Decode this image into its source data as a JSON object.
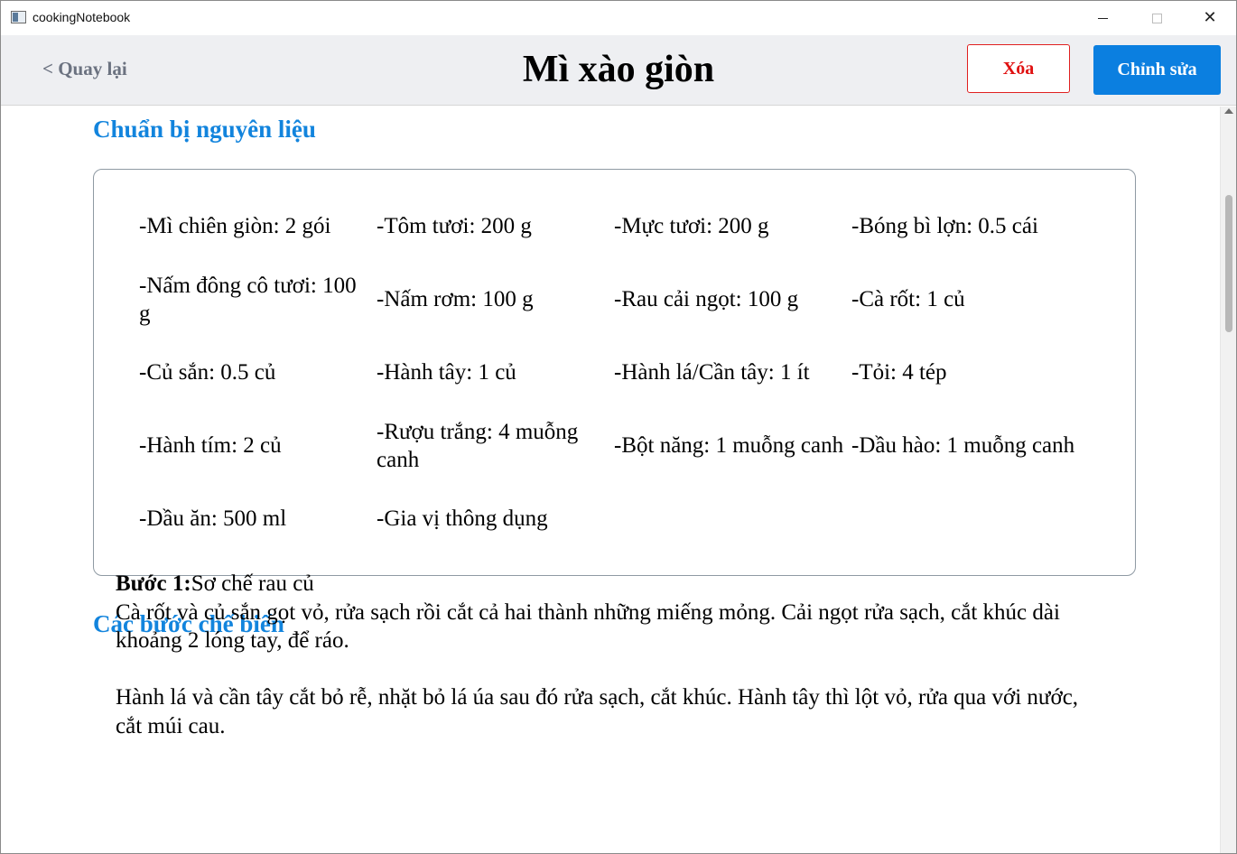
{
  "window": {
    "title": "cookingNotebook",
    "icons": {
      "app": "app-window-icon",
      "minimize": "minimize-icon",
      "maximize": "maximize-icon",
      "close": "close-icon"
    },
    "close_glyph": "✕"
  },
  "header": {
    "back_label": "< Quay lại",
    "title": "Mì xào giòn",
    "delete_label": "Xóa",
    "edit_label": "Chỉnh sửa"
  },
  "colors": {
    "accent": "#0b7fe0",
    "heading": "#1284dd",
    "danger": "#e01010",
    "header_bg": "#eeeff2",
    "back_link": "#6b7280"
  },
  "ingredients": {
    "heading": "Chuẩn bị nguyên liệu",
    "items": [
      "-Mì chiên giòn: 2 gói",
      "-Tôm tươi: 200 g",
      "-Mực tươi: 200 g",
      "-Bóng bì lợn: 0.5 cái",
      "-Nấm đông cô tươi: 100 g",
      "-Nấm rơm: 100 g",
      "-Rau cải ngọt: 100 g",
      "-Cà rốt: 1 củ",
      "-Củ sắn: 0.5 củ",
      "-Hành tây: 1 củ",
      "-Hành lá/Cần tây: 1 ít",
      "-Tỏi: 4 tép",
      "-Hành tím: 2 củ",
      "-Rượu trắng: 4 muỗng canh",
      "-Bột năng: 1 muỗng canh",
      "-Dầu hào: 1 muỗng canh",
      "-Dầu ăn: 500 ml",
      "-Gia vị thông dụng"
    ]
  },
  "steps": {
    "heading": "Các bước chế biến",
    "step1": {
      "label": "Bước 1:",
      "title": "Sơ chế rau củ",
      "paragraphs": [
        "Cà rốt và củ sắn gọt vỏ, rửa sạch rồi cắt cả hai thành những miếng mỏng. Cải ngọt rửa sạch, cắt khúc dài khoảng 2 lóng tay, để ráo.",
        "Hành lá và cần tây cắt bỏ rễ, nhặt bỏ lá úa sau đó rửa sạch, cắt khúc. Hành tây thì lột vỏ, rửa qua với nước, cắt múi cau."
      ]
    }
  }
}
